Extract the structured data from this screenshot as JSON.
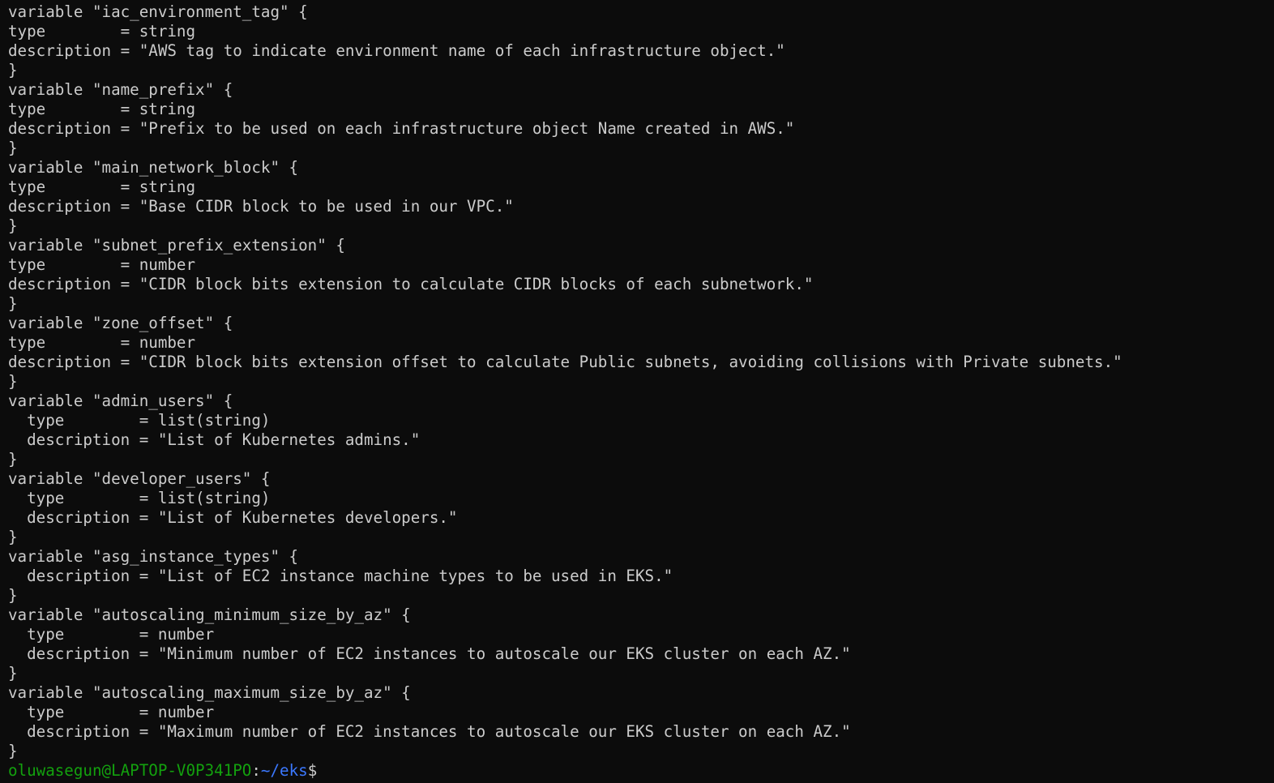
{
  "terminal": {
    "lines": [
      "variable \"iac_environment_tag\" {",
      "type        = string",
      "description = \"AWS tag to indicate environment name of each infrastructure object.\"",
      "}",
      "variable \"name_prefix\" {",
      "type        = string",
      "description = \"Prefix to be used on each infrastructure object Name created in AWS.\"",
      "}",
      "variable \"main_network_block\" {",
      "type        = string",
      "description = \"Base CIDR block to be used in our VPC.\"",
      "}",
      "variable \"subnet_prefix_extension\" {",
      "type        = number",
      "description = \"CIDR block bits extension to calculate CIDR blocks of each subnetwork.\"",
      "}",
      "variable \"zone_offset\" {",
      "type        = number",
      "description = \"CIDR block bits extension offset to calculate Public subnets, avoiding collisions with Private subnets.\"",
      "}",
      "variable \"admin_users\" {",
      "  type        = list(string)",
      "  description = \"List of Kubernetes admins.\"",
      "}",
      "variable \"developer_users\" {",
      "  type        = list(string)",
      "  description = \"List of Kubernetes developers.\"",
      "}",
      "variable \"asg_instance_types\" {",
      "  description = \"List of EC2 instance machine types to be used in EKS.\"",
      "}",
      "variable \"autoscaling_minimum_size_by_az\" {",
      "  type        = number",
      "  description = \"Minimum number of EC2 instances to autoscale our EKS cluster on each AZ.\"",
      "}",
      "variable \"autoscaling_maximum_size_by_az\" {",
      "  type        = number",
      "  description = \"Maximum number of EC2 instances to autoscale our EKS cluster on each AZ.\"",
      "}"
    ],
    "prompt": {
      "user_host": "oluwasegun@LAPTOP-V0P341PO",
      "separator": ":",
      "path": "~/eks",
      "symbol": "$"
    }
  },
  "colors": {
    "background": "#0c0c0c",
    "foreground": "#cccccc",
    "prompt_user": "#13a10e",
    "prompt_path": "#3b78ff"
  }
}
